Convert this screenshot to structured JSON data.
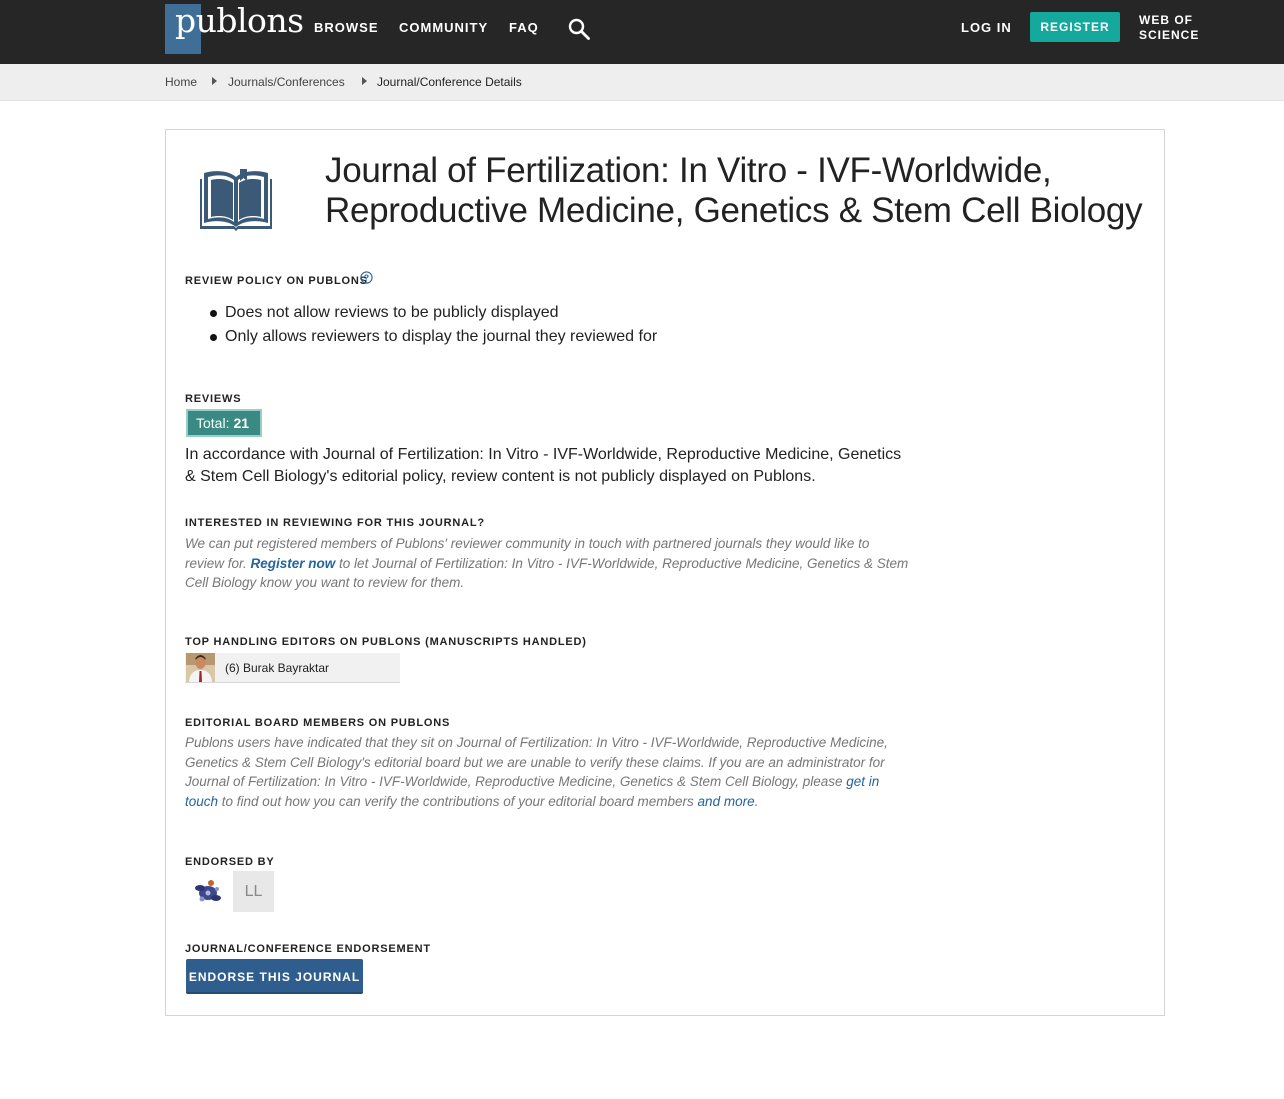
{
  "header": {
    "logo_text": "publons",
    "nav": [
      "BROWSE",
      "COMMUNITY",
      "FAQ"
    ],
    "login": "LOG IN",
    "register": "REGISTER",
    "wos_line1": "WEB OF",
    "wos_line2": "SCIENCE",
    "colors": {
      "bar": "#262626",
      "register": "#15a89c",
      "logo_box": "#3f6e96"
    }
  },
  "breadcrumb": [
    "Home",
    "Journals/Conferences",
    "Journal/Conference Details"
  ],
  "journal": {
    "title_line1": "Journal of Fertilization: In Vitro - IVF-Worldwide,",
    "title_line2": "Reproductive Medicine, Genetics & Stem Cell Biology"
  },
  "review_policy": {
    "heading": "REVIEW POLICY ON PUBLONS",
    "items": [
      "Does not allow reviews to be publicly displayed",
      "Only allows reviewers to display the journal they reviewed for"
    ]
  },
  "reviews": {
    "heading": "REVIEWS",
    "total_label": "Total:",
    "total_value": "21",
    "policy_text": "In accordance with Journal of Fertilization: In Vitro - IVF-Worldwide, Reproductive Medicine, Genetics & Stem Cell Biology's editorial policy, review content is not publicly displayed on Publons."
  },
  "interested": {
    "heading": "INTERESTED IN REVIEWING FOR THIS JOURNAL?",
    "text_before": "We can put registered members of Publons' reviewer community in touch with partnered journals they would like to review for. ",
    "link": "Register now",
    "text_after": " to let Journal of Fertilization: In Vitro - IVF-Worldwide, Reproductive Medicine, Genetics & Stem Cell Biology know you want to review for them."
  },
  "editors": {
    "heading": "TOP HANDLING EDITORS ON PUBLONS (MANUSCRIPTS HANDLED)",
    "items": [
      {
        "name": "(6) Burak Bayraktar"
      }
    ]
  },
  "board": {
    "heading": "EDITORIAL BOARD MEMBERS ON PUBLONS",
    "text_before": "Publons users have indicated that they sit on Journal of Fertilization: In Vitro - IVF-Worldwide, Reproductive Medicine, Genetics & Stem Cell Biology's editorial board but we are unable to verify these claims. If you are an administrator for Journal of Fertilization: In Vitro - IVF-Worldwide, Reproductive Medicine, Genetics & Stem Cell Biology, please ",
    "link1": "get in touch",
    "text_middle": " to find out how you can verify the contributions of your editorial board members ",
    "link2": "and more",
    "text_end": "."
  },
  "endorsed": {
    "heading": "ENDORSED BY",
    "initials": "LL"
  },
  "endorsement": {
    "heading": "JOURNAL/CONFERENCE ENDORSEMENT",
    "button": "ENDORSE THIS JOURNAL"
  }
}
